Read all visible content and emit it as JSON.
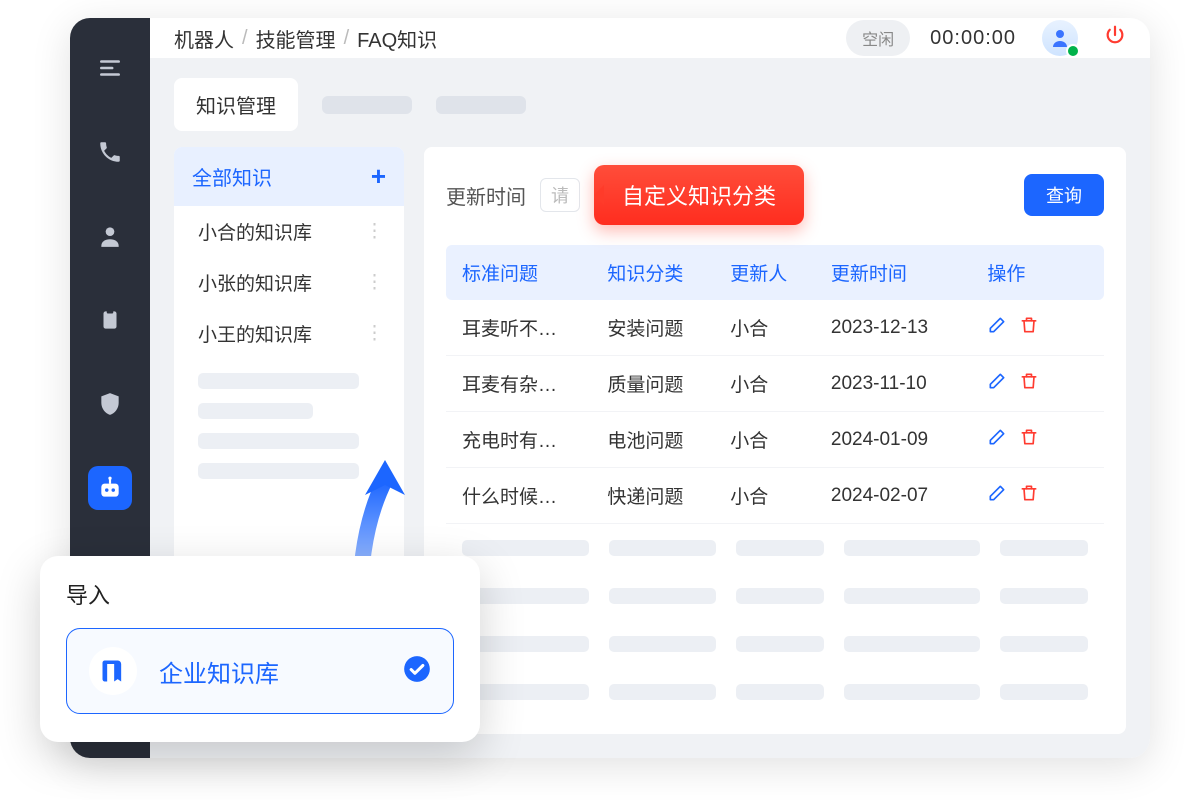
{
  "breadcrumb": {
    "a": "机器人",
    "b": "技能管理",
    "c": "FAQ知识"
  },
  "topbar": {
    "status": "空闲",
    "timer": "00:00:00"
  },
  "tabs": {
    "active": "知识管理"
  },
  "tree": {
    "all": "全部知识",
    "items": [
      "小合的知识库",
      "小张的知识库",
      "小王的知识库"
    ]
  },
  "filter": {
    "label": "更新时间",
    "placeholder_fragment": "请",
    "callout": "自定义知识分类",
    "search_btn": "查询"
  },
  "table": {
    "headers": {
      "q": "标准问题",
      "cat": "知识分类",
      "by": "更新人",
      "at": "更新时间",
      "ops": "操作"
    },
    "rows": [
      {
        "q": "耳麦听不…",
        "cat": "安装问题",
        "by": "小合",
        "at": "2023-12-13"
      },
      {
        "q": "耳麦有杂…",
        "cat": "质量问题",
        "by": "小合",
        "at": "2023-11-10"
      },
      {
        "q": "充电时有…",
        "cat": "电池问题",
        "by": "小合",
        "at": "2024-01-09"
      },
      {
        "q": "什么时候…",
        "cat": "快递问题",
        "by": "小合",
        "at": "2024-02-07"
      }
    ]
  },
  "import": {
    "title": "导入",
    "item": "企业知识库"
  }
}
